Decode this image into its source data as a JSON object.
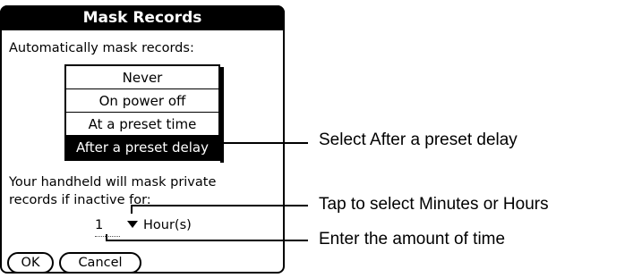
{
  "dialog": {
    "title": "Mask Records",
    "prompt": "Automatically mask records:",
    "options": [
      {
        "label": "Never",
        "selected": false
      },
      {
        "label": "On power off",
        "selected": false
      },
      {
        "label": "At a preset time",
        "selected": false
      },
      {
        "label": "After a preset delay",
        "selected": true
      }
    ],
    "info_line1": "Your handheld will mask private",
    "info_line2": "records if inactive for:",
    "amount_value": "1",
    "unit_value": "Hour(s)",
    "ok_label": "OK",
    "cancel_label": "Cancel"
  },
  "callouts": {
    "select_delay": "Select After a preset delay",
    "tap_units": "Tap to select Minutes or Hours",
    "enter_amount": "Enter the amount of time"
  },
  "colors": {
    "foreground": "#000000",
    "background": "#ffffff"
  },
  "icons": {
    "picker": "down-triangle-icon"
  }
}
